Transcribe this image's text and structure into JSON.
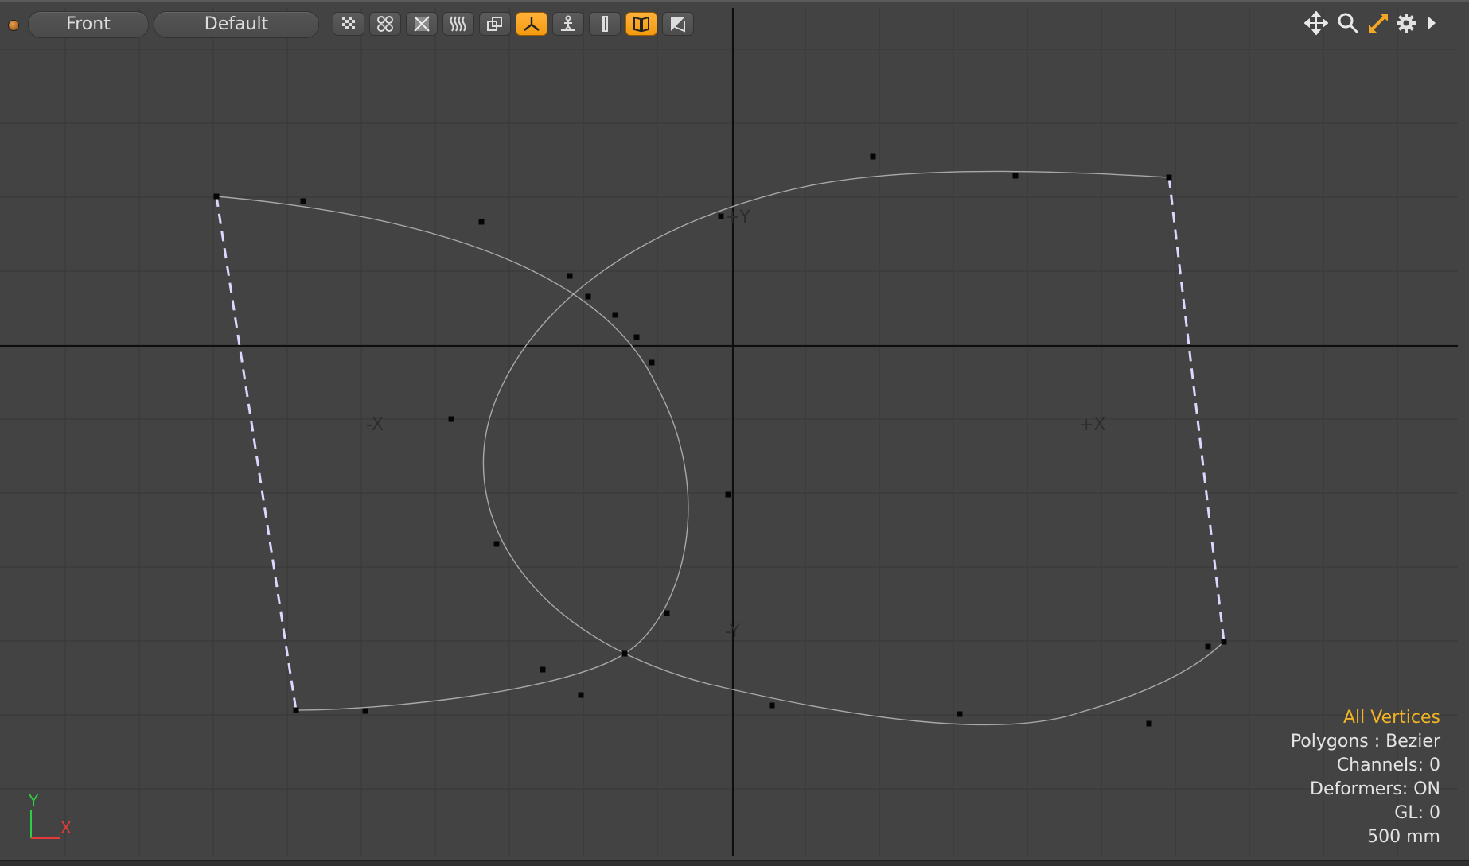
{
  "toolbar": {
    "view_label": "Front",
    "style_label": "Default",
    "buttons": [
      {
        "name": "checker-icon",
        "active": false
      },
      {
        "name": "grid-dots-icon",
        "active": false
      },
      {
        "name": "wireframe-x-icon",
        "active": false
      },
      {
        "name": "waves-icon",
        "active": false
      },
      {
        "name": "overlap-squares-icon",
        "active": false
      },
      {
        "name": "axis-tripod-icon",
        "active": true
      },
      {
        "name": "figure-stand-icon",
        "active": false
      },
      {
        "name": "half-shape-icon",
        "active": false
      },
      {
        "name": "book-icon",
        "active": true
      },
      {
        "name": "corner-arrow-icon",
        "active": false
      }
    ],
    "right_icons": [
      "move-icon",
      "zoom-icon",
      "scale-icon",
      "gear-icon",
      "play-arrow-icon"
    ]
  },
  "axis_labels": {
    "pos_y": "+Y",
    "neg_y": "-Y",
    "neg_x": "-X",
    "pos_x": "+X"
  },
  "info": {
    "selection_mode": "All Vertices",
    "polygons": "Polygons : Bezier",
    "channels": "Channels: 0",
    "deformers": "Deformers: ON",
    "gl": "GL: 0",
    "grid_size": "500 mm"
  },
  "gizmo": {
    "y_label": "Y",
    "x_label": "X"
  },
  "colors": {
    "viewport_bg": "#434343",
    "grid": "#3a3a3a",
    "axis": "#111111",
    "curve": "#a8a8a8",
    "dashed_edge": "#dcd7ff",
    "accent": "#f5a623",
    "selection_text": "#f2b324"
  }
}
